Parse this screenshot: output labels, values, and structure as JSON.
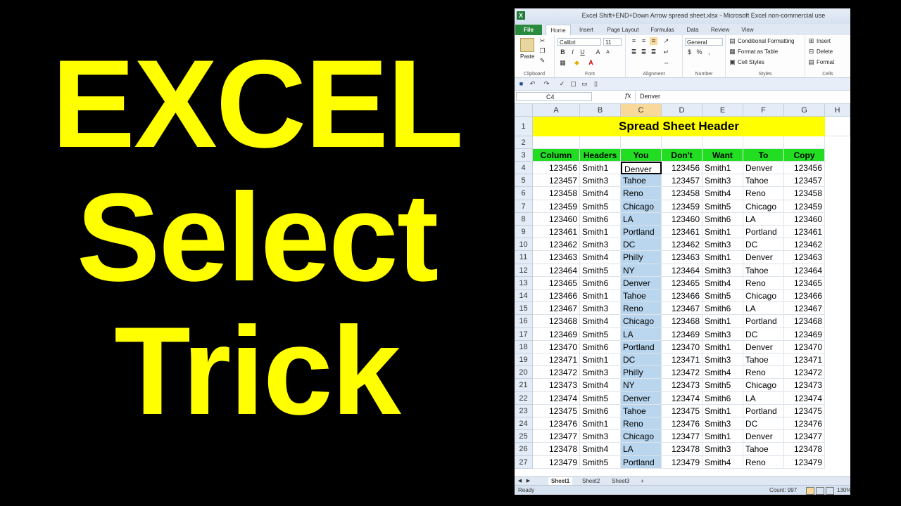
{
  "overlay": {
    "line1": "EXCEL",
    "line2": "Select",
    "line3": "Trick"
  },
  "window": {
    "title": "Excel Shift+END+Down Arrow spread sheet.xlsx  -  Microsoft Excel non-commercial use",
    "tabs": [
      "File",
      "Home",
      "Insert",
      "Page Layout",
      "Formulas",
      "Data",
      "Review",
      "View"
    ],
    "active_tab": "Home"
  },
  "ribbon": {
    "clipboard": {
      "paste": "Paste",
      "label": "Clipboard"
    },
    "font": {
      "name": "Calibri",
      "size": "11",
      "label": "Font",
      "bold": "B",
      "italic": "I",
      "underline": "U"
    },
    "alignment": {
      "label": "Alignment"
    },
    "number": {
      "format": "General",
      "label": "Number",
      "currency": "$",
      "percent": "%"
    },
    "styles": {
      "conditional": "Conditional Formatting",
      "table": "Format as Table",
      "cell": "Cell Styles",
      "label": "Styles"
    },
    "cells": {
      "insert": "Insert",
      "delete": "Delete",
      "format": "Format",
      "label": "Cells"
    }
  },
  "formula_bar": {
    "name_box": "C4",
    "fx": "fx",
    "value": "Denver"
  },
  "grid": {
    "columns": [
      "A",
      "B",
      "C",
      "D",
      "E",
      "F",
      "G",
      "H"
    ],
    "selected_column": "C",
    "banner": "Spread Sheet Header",
    "headers": [
      "Column",
      "Headers",
      "You",
      "Don't",
      "Want",
      "To",
      "Copy"
    ],
    "rows": [
      {
        "n": "4",
        "a": "123456",
        "b": "Smith1",
        "c": "Denver",
        "d": "123456",
        "e": "Smith1",
        "f": "Denver",
        "g": "123456"
      },
      {
        "n": "5",
        "a": "123457",
        "b": "Smith3",
        "c": "Tahoe",
        "d": "123457",
        "e": "Smith3",
        "f": "Tahoe",
        "g": "123457"
      },
      {
        "n": "6",
        "a": "123458",
        "b": "Smith4",
        "c": "Reno",
        "d": "123458",
        "e": "Smith4",
        "f": "Reno",
        "g": "123458"
      },
      {
        "n": "7",
        "a": "123459",
        "b": "Smith5",
        "c": "Chicago",
        "d": "123459",
        "e": "Smith5",
        "f": "Chicago",
        "g": "123459"
      },
      {
        "n": "8",
        "a": "123460",
        "b": "Smith6",
        "c": "LA",
        "d": "123460",
        "e": "Smith6",
        "f": "LA",
        "g": "123460"
      },
      {
        "n": "9",
        "a": "123461",
        "b": "Smith1",
        "c": "Portland",
        "d": "123461",
        "e": "Smith1",
        "f": "Portland",
        "g": "123461"
      },
      {
        "n": "10",
        "a": "123462",
        "b": "Smith3",
        "c": "DC",
        "d": "123462",
        "e": "Smith3",
        "f": "DC",
        "g": "123462"
      },
      {
        "n": "11",
        "a": "123463",
        "b": "Smith4",
        "c": "Philly",
        "d": "123463",
        "e": "Smith1",
        "f": "Denver",
        "g": "123463"
      },
      {
        "n": "12",
        "a": "123464",
        "b": "Smith5",
        "c": "NY",
        "d": "123464",
        "e": "Smith3",
        "f": "Tahoe",
        "g": "123464"
      },
      {
        "n": "13",
        "a": "123465",
        "b": "Smith6",
        "c": "Denver",
        "d": "123465",
        "e": "Smith4",
        "f": "Reno",
        "g": "123465"
      },
      {
        "n": "14",
        "a": "123466",
        "b": "Smith1",
        "c": "Tahoe",
        "d": "123466",
        "e": "Smith5",
        "f": "Chicago",
        "g": "123466"
      },
      {
        "n": "15",
        "a": "123467",
        "b": "Smith3",
        "c": "Reno",
        "d": "123467",
        "e": "Smith6",
        "f": "LA",
        "g": "123467"
      },
      {
        "n": "16",
        "a": "123468",
        "b": "Smith4",
        "c": "Chicago",
        "d": "123468",
        "e": "Smith1",
        "f": "Portland",
        "g": "123468"
      },
      {
        "n": "17",
        "a": "123469",
        "b": "Smith5",
        "c": "LA",
        "d": "123469",
        "e": "Smith3",
        "f": "DC",
        "g": "123469"
      },
      {
        "n": "18",
        "a": "123470",
        "b": "Smith6",
        "c": "Portland",
        "d": "123470",
        "e": "Smith1",
        "f": "Denver",
        "g": "123470"
      },
      {
        "n": "19",
        "a": "123471",
        "b": "Smith1",
        "c": "DC",
        "d": "123471",
        "e": "Smith3",
        "f": "Tahoe",
        "g": "123471"
      },
      {
        "n": "20",
        "a": "123472",
        "b": "Smith3",
        "c": "Philly",
        "d": "123472",
        "e": "Smith4",
        "f": "Reno",
        "g": "123472"
      },
      {
        "n": "21",
        "a": "123473",
        "b": "Smith4",
        "c": "NY",
        "d": "123473",
        "e": "Smith5",
        "f": "Chicago",
        "g": "123473"
      },
      {
        "n": "22",
        "a": "123474",
        "b": "Smith5",
        "c": "Denver",
        "d": "123474",
        "e": "Smith6",
        "f": "LA",
        "g": "123474"
      },
      {
        "n": "23",
        "a": "123475",
        "b": "Smith6",
        "c": "Tahoe",
        "d": "123475",
        "e": "Smith1",
        "f": "Portland",
        "g": "123475"
      },
      {
        "n": "24",
        "a": "123476",
        "b": "Smith1",
        "c": "Reno",
        "d": "123476",
        "e": "Smith3",
        "f": "DC",
        "g": "123476"
      },
      {
        "n": "25",
        "a": "123477",
        "b": "Smith3",
        "c": "Chicago",
        "d": "123477",
        "e": "Smith1",
        "f": "Denver",
        "g": "123477"
      },
      {
        "n": "26",
        "a": "123478",
        "b": "Smith4",
        "c": "LA",
        "d": "123478",
        "e": "Smith3",
        "f": "Tahoe",
        "g": "123478"
      },
      {
        "n": "27",
        "a": "123479",
        "b": "Smith5",
        "c": "Portland",
        "d": "123479",
        "e": "Smith4",
        "f": "Reno",
        "g": "123479"
      }
    ]
  },
  "sheets": [
    "Sheet1",
    "Sheet2",
    "Sheet3"
  ],
  "status": {
    "ready": "Ready",
    "count": "Count: 997",
    "zoom": "130%"
  },
  "colors": {
    "banner": "#ffff00",
    "header_row": "#22dd22",
    "selection": "#b9d6ee",
    "overlay_text": "#ffff00"
  }
}
